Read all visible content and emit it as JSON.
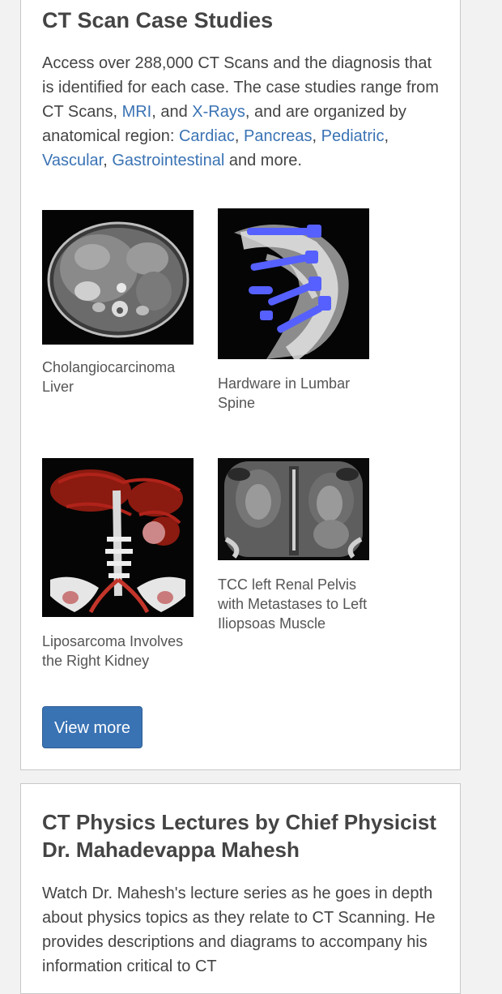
{
  "case_studies": {
    "title": "CT Scan Case Studies",
    "intro": {
      "t1": "Access over 288,000 CT Scans and the diagnosis that is identified for each case. The case studies range from CT Scans, ",
      "link_mri": "MRI",
      "t2": ", and ",
      "link_xrays": "X-Rays",
      "t3": ", and are organized by anatomical region: ",
      "link_cardiac": "Cardiac",
      "t4": ", ",
      "link_pancreas": "Pancreas",
      "t5": ", ",
      "link_pediatric": "Pediatric",
      "t6": ", ",
      "link_vascular": "Vascular",
      "t7": ", ",
      "link_gastro": "Gastrointestinal",
      "t8": " and more."
    },
    "cases": [
      {
        "caption": "Cholangiocarcinoma Liver"
      },
      {
        "caption": "Hardware in Lumbar Spine"
      },
      {
        "caption": "Liposarcoma Involves the Right Kidney"
      },
      {
        "caption": "TCC left Renal Pelvis with Metastases to Left Iliopsoas Muscle"
      }
    ],
    "view_more": "View more"
  },
  "lectures": {
    "title": "CT Physics Lectures by Chief Physicist Dr. Mahadevappa Mahesh",
    "intro": "Watch Dr. Mahesh's lecture series as he goes in depth about physics topics as they relate to CT Scanning. He provides descriptions and diagrams to accompany his information critical to CT"
  },
  "colors": {
    "link": "#3a73b4",
    "button": "#3a73b4",
    "hardware_overlay": "#5560ff"
  }
}
